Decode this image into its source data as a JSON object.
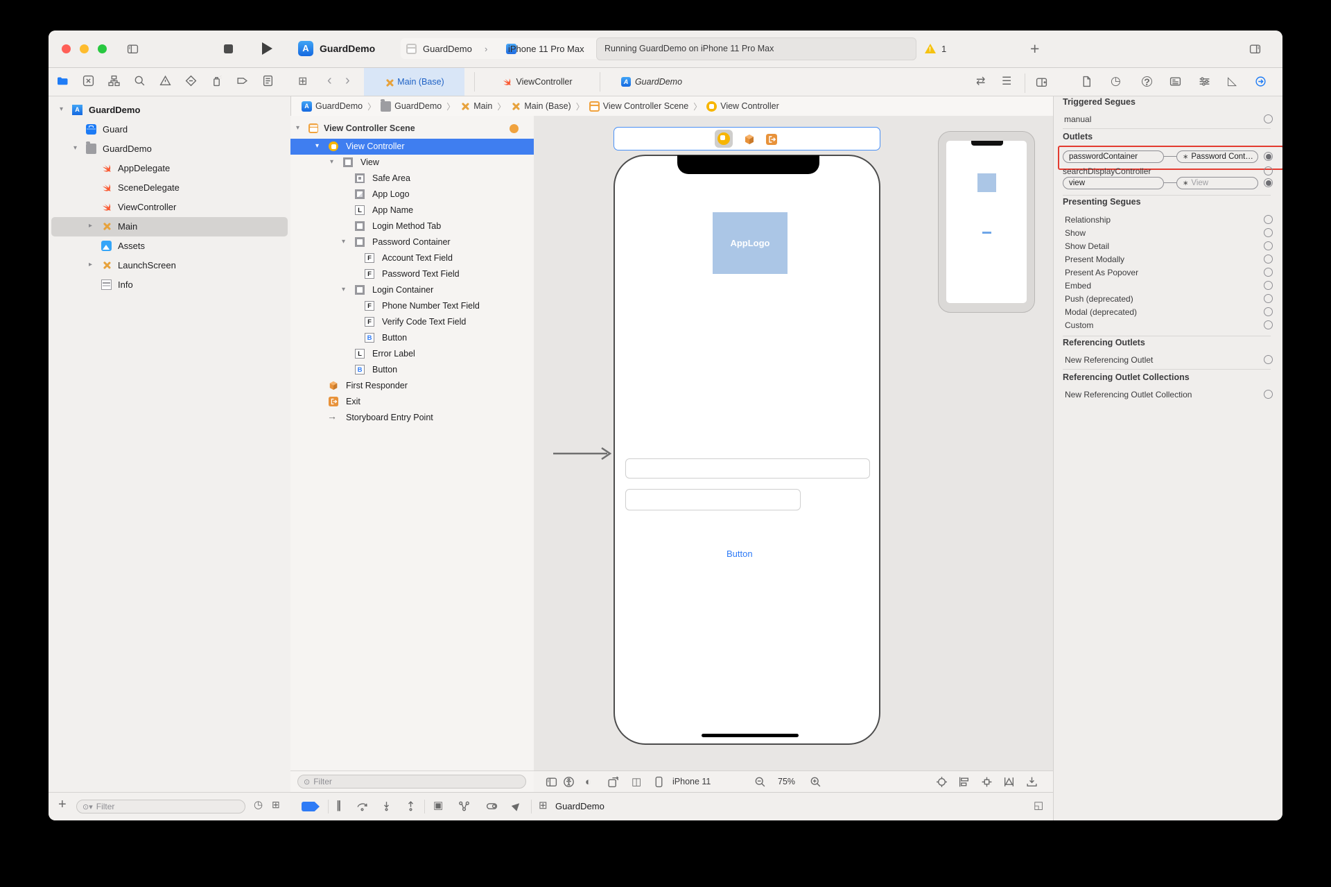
{
  "toolbar": {
    "title": "GuardDemo",
    "scheme_project": "GuardDemo",
    "scheme_device": "iPhone 11 Pro Max",
    "status": "Running GuardDemo on iPhone 11 Pro Max",
    "warning_count": "1"
  },
  "editor_tabs": {
    "tab1": "Main (Base)",
    "tab2": "ViewController",
    "tab3": "GuardDemo"
  },
  "breadcrumb": {
    "i0": "GuardDemo",
    "i1": "GuardDemo",
    "i2": "Main",
    "i3": "Main (Base)",
    "i4": "View Controller Scene",
    "i5": "View Controller"
  },
  "navigator": {
    "filter_placeholder": "Filter",
    "items": [
      {
        "label": "GuardDemo"
      },
      {
        "label": "Guard"
      },
      {
        "label": "GuardDemo"
      },
      {
        "label": "AppDelegate"
      },
      {
        "label": "SceneDelegate"
      },
      {
        "label": "ViewController"
      },
      {
        "label": "Main"
      },
      {
        "label": "Assets"
      },
      {
        "label": "LaunchScreen"
      },
      {
        "label": "Info"
      }
    ]
  },
  "outline": {
    "header": "View Controller Scene",
    "filter_placeholder": "Filter",
    "items": [
      {
        "label": "View Controller"
      },
      {
        "label": "View"
      },
      {
        "label": "Safe Area"
      },
      {
        "label": "App Logo"
      },
      {
        "label": "App Name"
      },
      {
        "label": "Login Method Tab"
      },
      {
        "label": "Password Container"
      },
      {
        "label": "Account Text Field"
      },
      {
        "label": "Password Text Field"
      },
      {
        "label": "Login Container"
      },
      {
        "label": "Phone Number Text Field"
      },
      {
        "label": "Verify Code Text Field"
      },
      {
        "label": "Button"
      },
      {
        "label": "Error Label"
      },
      {
        "label": "Button"
      },
      {
        "label": "First Responder"
      },
      {
        "label": "Exit"
      },
      {
        "label": "Storyboard Entry Point"
      }
    ]
  },
  "canvas": {
    "app_logo": "AppLogo",
    "button_label": "Button",
    "device_name": "iPhone 11",
    "zoom_level": "75%"
  },
  "debug": {
    "process_name": "GuardDemo"
  },
  "inspector": {
    "triggered": {
      "header": "Triggered Segues",
      "manual": "manual"
    },
    "outlets": {
      "header": "Outlets",
      "password_name": "passwordContainer",
      "password_target": "Password Cont…",
      "search": "searchDisplayController",
      "view_name": "view",
      "view_target": "View"
    },
    "presenting": {
      "header": "Presenting Segues",
      "rows": [
        {
          "label": "Relationship"
        },
        {
          "label": "Show"
        },
        {
          "label": "Show Detail"
        },
        {
          "label": "Present Modally"
        },
        {
          "label": "Present As Popover"
        },
        {
          "label": "Embed"
        },
        {
          "label": "Push (deprecated)"
        },
        {
          "label": "Modal (deprecated)"
        },
        {
          "label": "Custom"
        }
      ]
    },
    "referencing": {
      "header": "Referencing Outlets",
      "row": "New Referencing Outlet"
    },
    "collections": {
      "header": "Referencing Outlet Collections",
      "row": "New Referencing Outlet Collection"
    }
  }
}
